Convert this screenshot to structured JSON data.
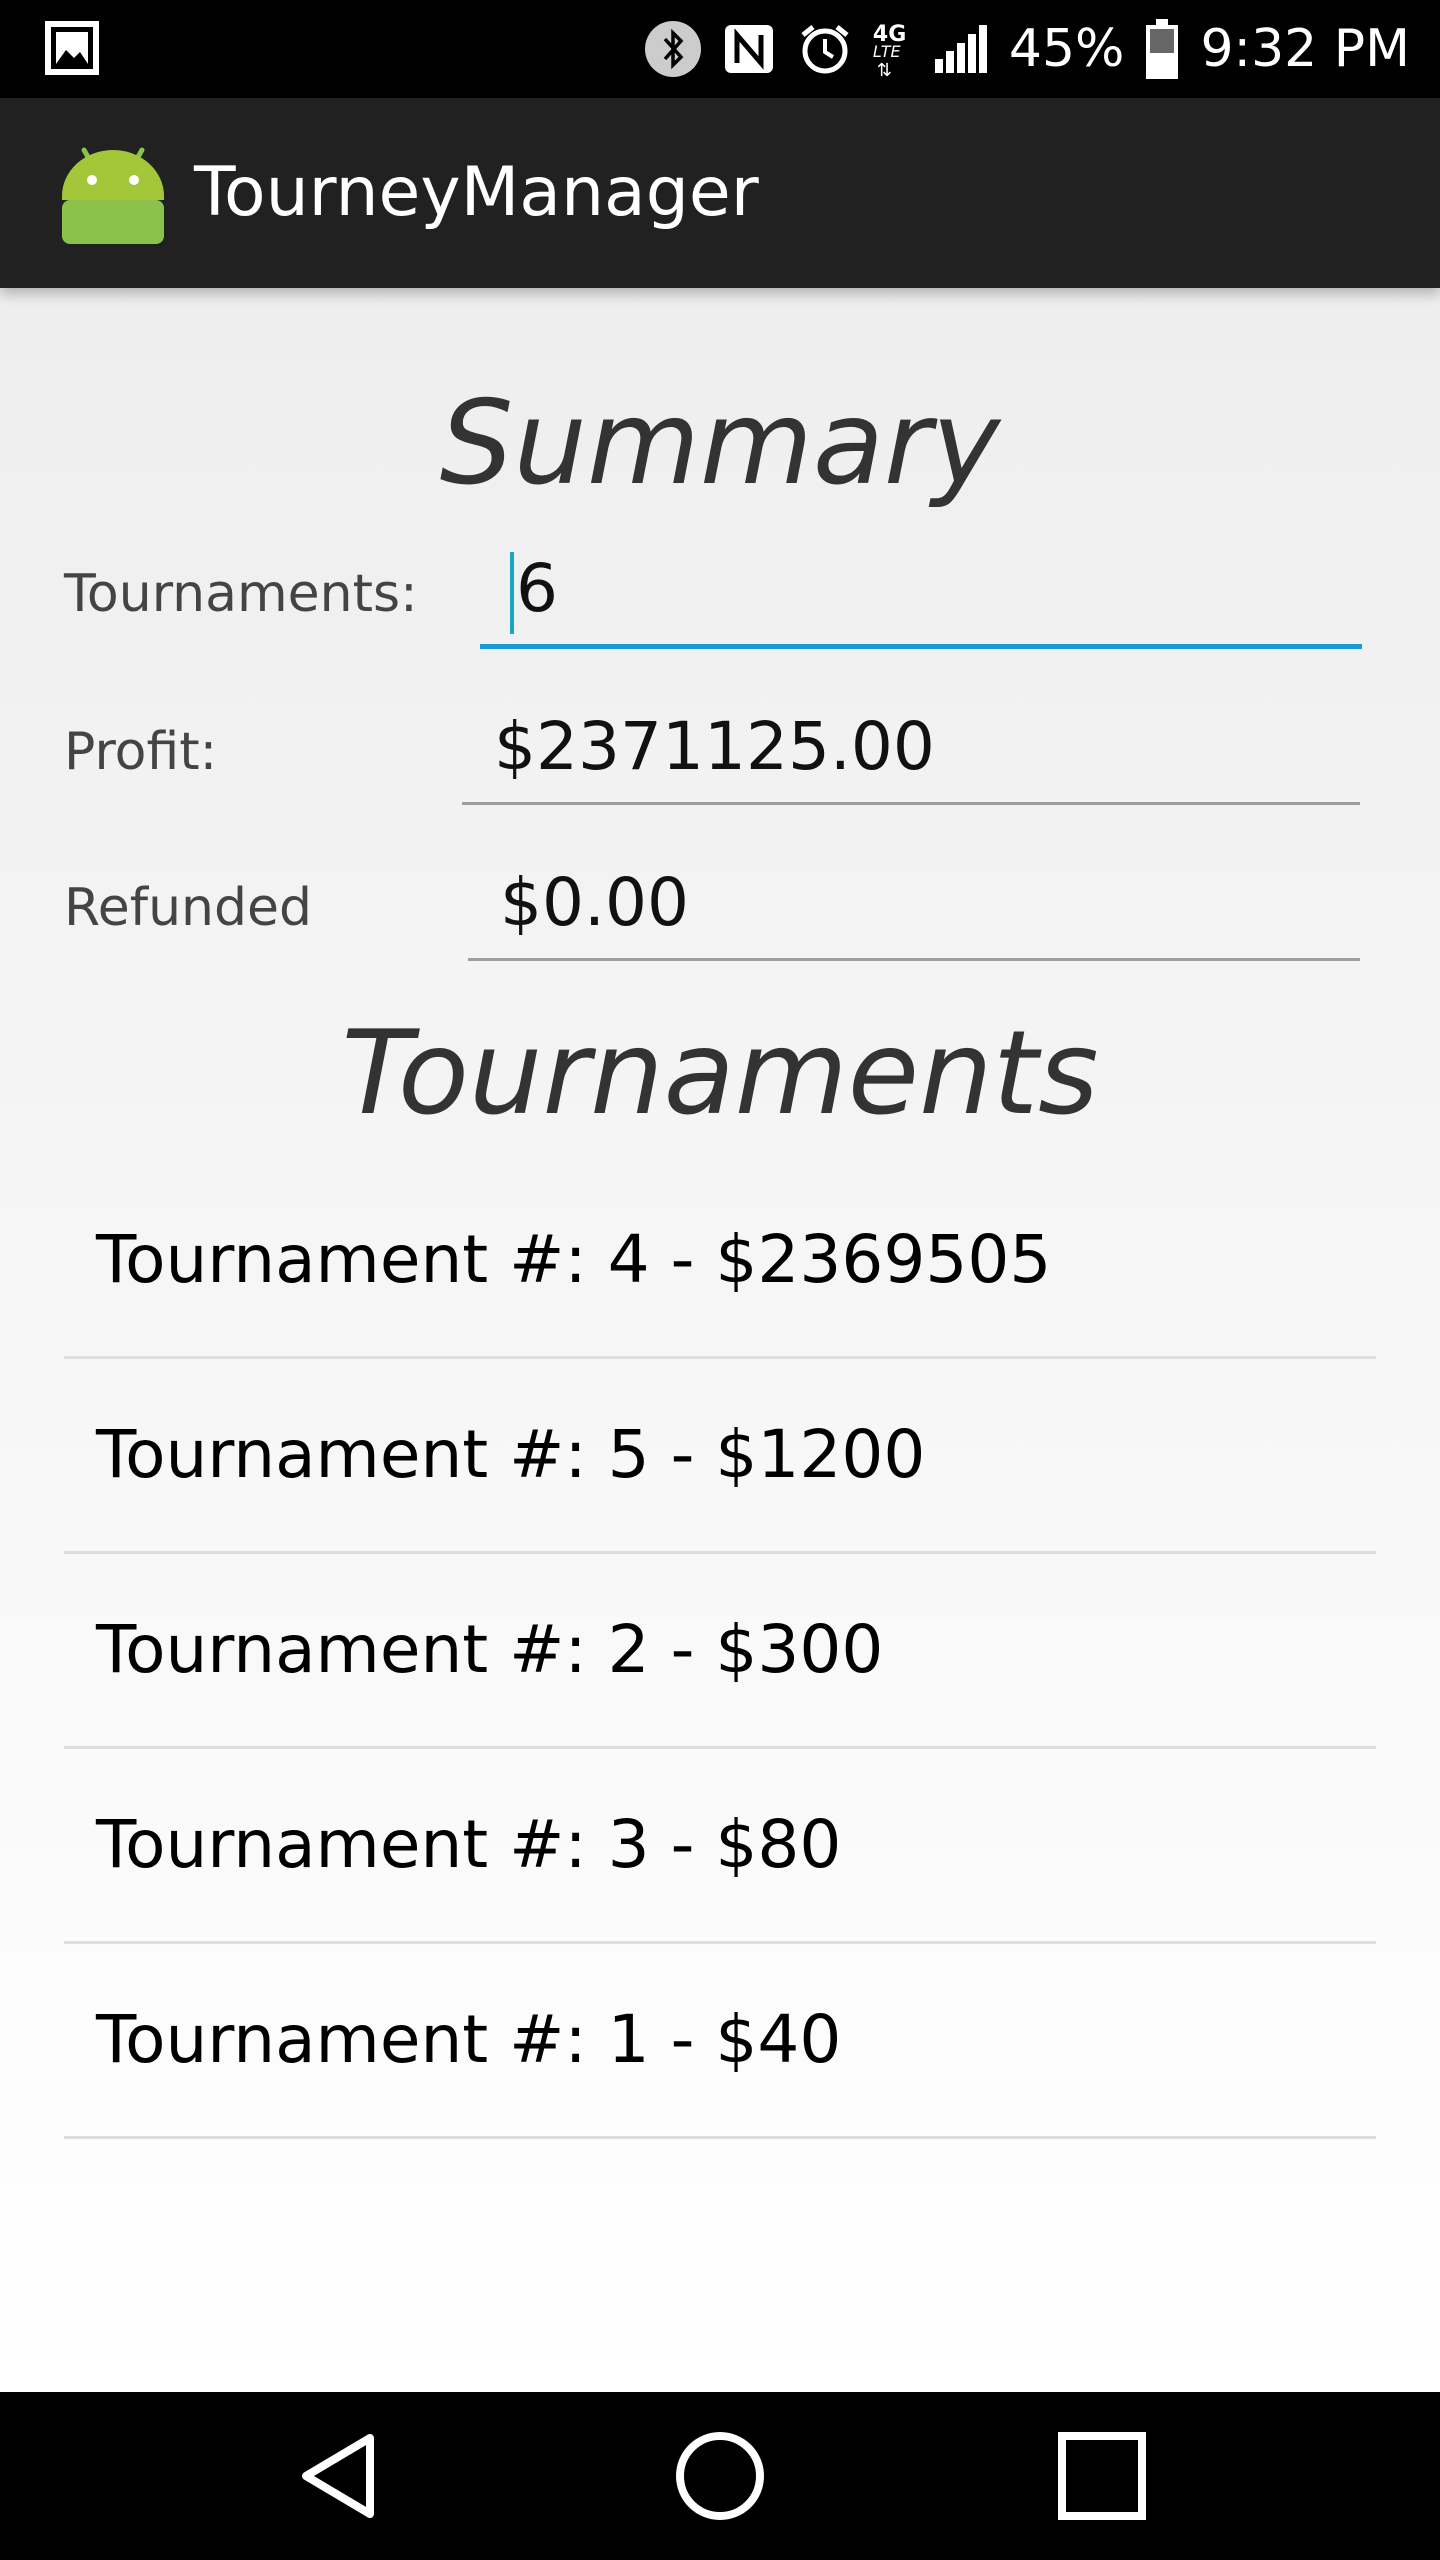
{
  "status_bar": {
    "icons": [
      "gallery-notification-icon",
      "bluetooth-icon",
      "nfc-icon",
      "alarm-icon",
      "lte-4g-icon",
      "signal-icon",
      "battery-icon"
    ],
    "network": "4G",
    "network_sub": "LTE",
    "battery": "45%",
    "time": "9:32 PM"
  },
  "app_bar": {
    "title": "TourneyManager",
    "logo_color": "#8bc34a"
  },
  "summary": {
    "title": "Summary",
    "tournaments_label": "Tournaments:",
    "tournaments_value": "6",
    "profit_label": "Profit:",
    "profit_value": "$2371125.00",
    "refunded_label": "Refunded",
    "refunded_value": "$0.00"
  },
  "tournaments": {
    "title": "Tournaments",
    "items": [
      {
        "label": "Tournament #: 4 - $2369505"
      },
      {
        "label": "Tournament #: 5 - $1200"
      },
      {
        "label": "Tournament #: 2 - $300"
      },
      {
        "label": "Tournament #: 3 - $80"
      },
      {
        "label": "Tournament #: 1 - $40"
      }
    ]
  },
  "nav_bar": {
    "buttons": [
      "back-icon",
      "home-icon",
      "recents-icon"
    ]
  },
  "colors": {
    "accent": "#1a9bd7",
    "app_bar": "#212121",
    "status_bar": "#000000"
  }
}
